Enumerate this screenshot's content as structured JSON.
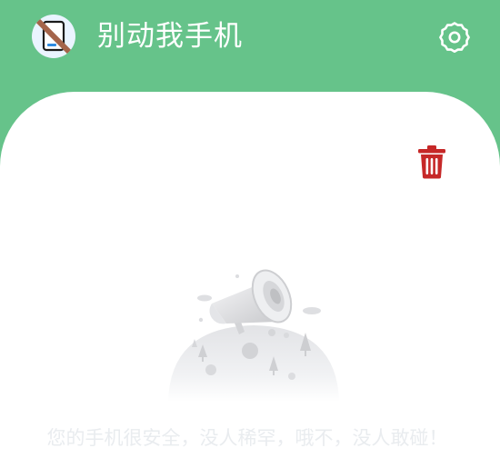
{
  "app": {
    "title": "别动我手机",
    "logo_icon": "phone-slash-icon"
  },
  "header": {
    "settings_icon": "gear-icon"
  },
  "toolbar": {
    "delete_icon": "trash-icon"
  },
  "empty_state": {
    "illustration_icon": "megaphone-on-globe-icon",
    "message": "您的手机很安全，没人稀罕，哦不，没人敢碰！"
  },
  "colors": {
    "header_background": "#66c38a",
    "card_background": "#ffffff",
    "delete_red": "#c62828",
    "empty_text": "#e9ecef"
  }
}
